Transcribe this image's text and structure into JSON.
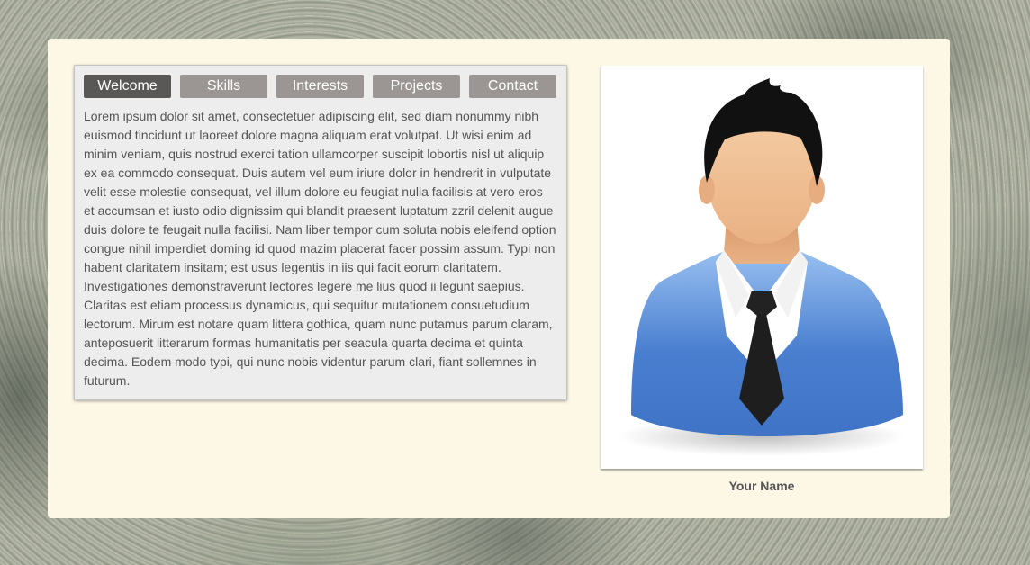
{
  "tabs": [
    {
      "label": "Welcome",
      "active": true
    },
    {
      "label": "Skills",
      "active": false
    },
    {
      "label": "Interests",
      "active": false
    },
    {
      "label": "Projects",
      "active": false
    },
    {
      "label": "Contact",
      "active": false
    }
  ],
  "content": {
    "text": "Lorem ipsum dolor sit amet, consectetuer adipiscing elit, sed diam nonummy nibh euismod tincidunt ut laoreet dolore magna aliquam erat volutpat. Ut wisi enim ad minim veniam, quis nostrud exerci tation ullamcorper suscipit lobortis nisl ut aliquip ex ea commodo consequat. Duis autem vel eum iriure dolor in hendrerit in vulputate velit esse molestie consequat, vel illum dolore eu feugiat nulla facilisis at vero eros et accumsan et iusto odio dignissim qui blandit praesent luptatum zzril delenit augue duis dolore te feugait nulla facilisi. Nam liber tempor cum soluta nobis eleifend option congue nihil imperdiet doming id quod mazim placerat facer possim assum. Typi non habent claritatem insitam; est usus legentis in iis qui facit eorum claritatem. Investigationes demonstraverunt lectores legere me lius quod ii legunt saepius. Claritas est etiam processus dynamicus, qui sequitur mutationem consuetudium lectorum. Mirum est notare quam littera gothica, quam nunc putamus parum claram, anteposuerit litterarum formas humanitatis per seacula quarta decima et quinta decima. Eodem modo typi, qui nunc nobis videntur parum clari, fiant sollemnes in futurum."
  },
  "profile": {
    "name": "Your Name",
    "avatar_icon": "person-avatar-icon"
  },
  "colors": {
    "panel_bg": "#fdf8e6",
    "tab_active": "#5a5856",
    "tab_inactive": "#9b9693",
    "suit_blue": "#4a7fd0",
    "text": "#555555"
  }
}
